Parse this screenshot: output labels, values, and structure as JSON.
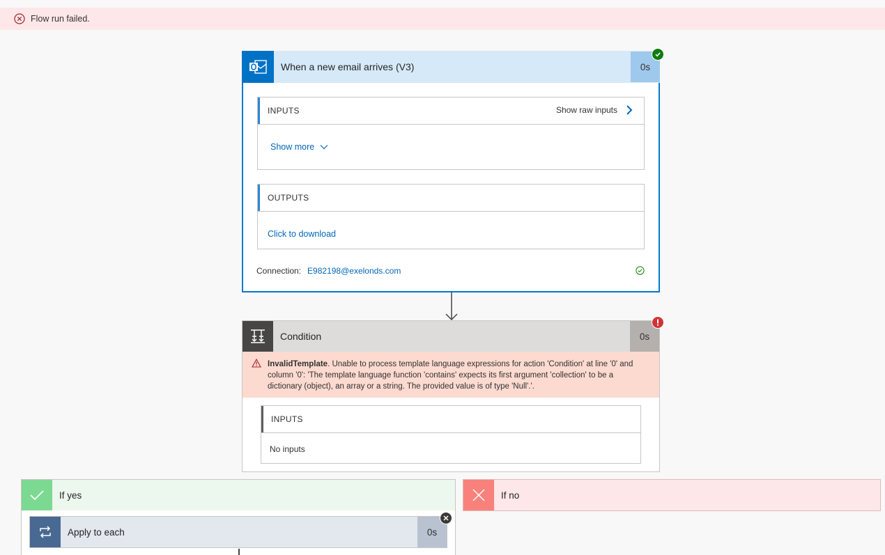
{
  "banner": {
    "text": "Flow run failed."
  },
  "trigger": {
    "title": "When a new email arrives (V3)",
    "duration": "0s",
    "inputs_label": "INPUTS",
    "show_raw_inputs": "Show raw inputs",
    "show_more": "Show more",
    "outputs_label": "OUTPUTS",
    "click_to_download": "Click to download",
    "connection_label": "Connection:",
    "connection_value": "E982198@exelonds.com"
  },
  "condition": {
    "title": "Condition",
    "duration": "0s",
    "error_title": "InvalidTemplate",
    "error_text": ". Unable to process template language expressions for action 'Condition' at line '0' and column '0': 'The template language function 'contains' expects its first argument 'collection' to be a dictionary (object), an array or a string. The provided value is of type 'Null'.'.",
    "inputs_label": "INPUTS",
    "no_inputs": "No inputs"
  },
  "branches": {
    "yes_label": "If yes",
    "no_label": "If no"
  },
  "apply_each": {
    "title": "Apply to each",
    "duration": "0s"
  },
  "colors": {
    "outlook_blue": "#0072c6",
    "header_blue": "#d6e9f8",
    "error_red": "#d13438",
    "success_green": "#107c10",
    "error_bg": "#fcdad0",
    "yes_green": "#7cd992",
    "no_red": "#f8827b"
  }
}
